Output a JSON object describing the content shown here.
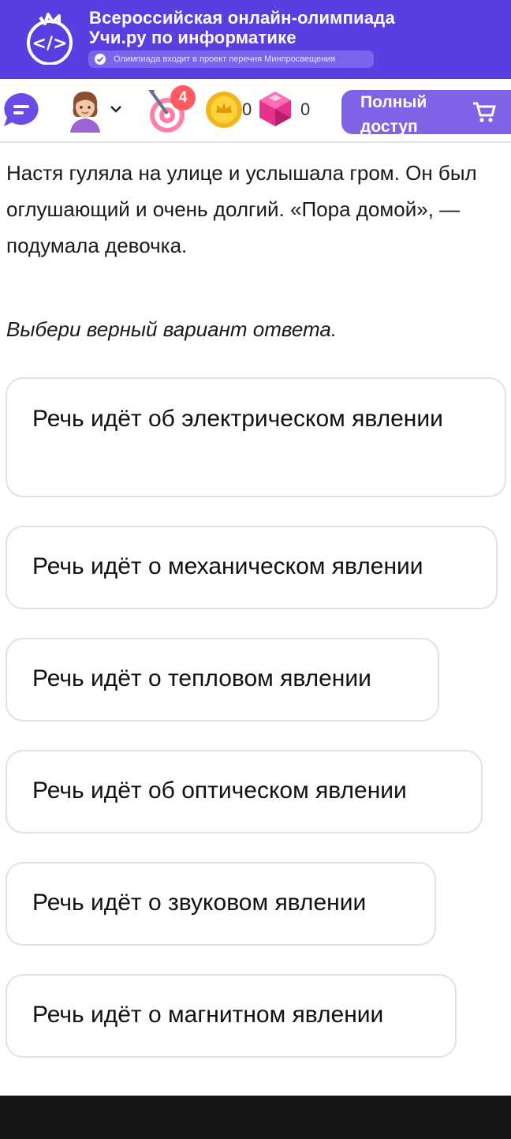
{
  "banner": {
    "title_line1": "Всероссийская онлайн-олимпиада",
    "title_line2": "Учи.ру по информатике",
    "badge": "Олимпиада входит в проект перечня Минпросвещения",
    "logo_glyph": "</>"
  },
  "toolbar": {
    "notification_count": "4",
    "coins": "0",
    "gems": "0",
    "full_access_label": "Полный доступ"
  },
  "question": {
    "text": "Настя гуляла на улице и услышала гром. Он был оглушающий и очень долгий. «Пора домой», — подумала девочка.",
    "instruction": "Выбери верный вариант ответа."
  },
  "options": [
    "Речь идёт об электрическом явлении",
    "Речь идёт о механическом явлении",
    "Речь идёт о тепловом явлении",
    "Речь идёт об оптическом явлении",
    "Речь идёт о звуковом явлении",
    "Речь идёт о магнитном явлении"
  ],
  "colors": {
    "banner": "#5a3ee0",
    "accent_button": "#7f62e6",
    "notification": "#ff5a62"
  },
  "icons": [
    "code-logo-icon",
    "check-circle-icon",
    "chat-icon",
    "avatar",
    "chevron-down-icon",
    "target-icon",
    "coin-icon",
    "gem-icon",
    "cart-icon"
  ]
}
